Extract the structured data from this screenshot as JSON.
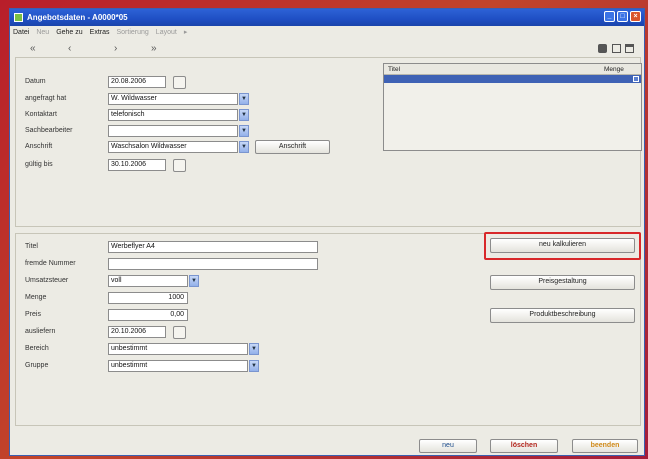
{
  "window": {
    "title": "Angebotsdaten - A0000*05"
  },
  "menu": {
    "items": [
      "Datei",
      "Neu",
      "Gehe zu",
      "Extras",
      "Sortierung",
      "Layout"
    ]
  },
  "nav": {
    "first": "«",
    "prev": "‹",
    "next": "›",
    "last": "»"
  },
  "top_form": {
    "datum": {
      "label": "Datum",
      "value": "20.08.2006"
    },
    "angefragt": {
      "label": "angefragt hat",
      "value": "W. Wildwasser"
    },
    "kontaktart": {
      "label": "Kontaktart",
      "value": "telefonisch"
    },
    "sachbearbeiter": {
      "label": "Sachbearbeiter",
      "value": ""
    },
    "anschrift": {
      "label": "Anschrift",
      "value": "Waschsalon Wildwasser",
      "button": "Anschrift"
    },
    "gueltig": {
      "label": "gültig bis",
      "value": "30.10.2006"
    }
  },
  "table": {
    "col_title": "Titel",
    "col_qty": "Menge"
  },
  "position_form": {
    "titel": {
      "label": "Titel",
      "value": "Werbeflyer A4"
    },
    "fremde": {
      "label": "fremde Nummer",
      "value": ""
    },
    "ust": {
      "label": "Umsatzsteuer",
      "value": "voll"
    },
    "menge": {
      "label": "Menge",
      "value": "1000"
    },
    "preis": {
      "label": "Preis",
      "value": "0,00"
    },
    "ausliefern": {
      "label": "ausliefern",
      "value": "20.10.2006"
    },
    "bereich": {
      "label": "Bereich",
      "value": "unbestimmt"
    },
    "gruppe": {
      "label": "Gruppe",
      "value": "unbestimmt"
    }
  },
  "actions": {
    "neu_kalkulieren": "neu kalkulieren",
    "preisgestaltung": "Preisgestaltung",
    "produktbeschreibung": "Produktbeschreibung"
  },
  "footer": {
    "neu": "neu",
    "loeschen": "löschen",
    "beenden": "beenden"
  },
  "colors": {
    "titlebar": "#1f4fc4",
    "highlight": "#d8282a",
    "loeschen": "#b3261e",
    "beenden": "#d08a1a"
  }
}
